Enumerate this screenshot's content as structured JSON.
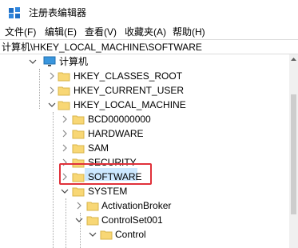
{
  "window": {
    "title": "注册表编辑器",
    "icon": "registry-editor-icon"
  },
  "menu": {
    "items": [
      {
        "label": "文件(F)"
      },
      {
        "label": "编辑(E)"
      },
      {
        "label": "查看(V)"
      },
      {
        "label": "收藏夹(A)"
      },
      {
        "label": "帮助(H)"
      }
    ]
  },
  "address": {
    "path": "计算机\\HKEY_LOCAL_MACHINE\\SOFTWARE"
  },
  "tree": {
    "root": {
      "label": "计算机",
      "icon": "computer-icon",
      "state": "expanded"
    },
    "items": [
      {
        "label": "HKEY_CLASSES_ROOT",
        "state": "collapsed"
      },
      {
        "label": "HKEY_CURRENT_USER",
        "state": "collapsed"
      },
      {
        "label": "HKEY_LOCAL_MACHINE",
        "state": "expanded"
      },
      {
        "label": "BCD00000000",
        "state": "collapsed"
      },
      {
        "label": "HARDWARE",
        "state": "collapsed"
      },
      {
        "label": "SAM",
        "state": "collapsed"
      },
      {
        "label": "SECURITY",
        "state": "collapsed"
      },
      {
        "label": "SOFTWARE",
        "state": "collapsed",
        "selected": true
      },
      {
        "label": "SYSTEM",
        "state": "expanded"
      },
      {
        "label": "ActivationBroker",
        "state": "collapsed"
      },
      {
        "label": "ControlSet001",
        "state": "expanded"
      },
      {
        "label": "Control",
        "state": "expanded"
      }
    ]
  },
  "colors": {
    "highlight_box": "#e0313a",
    "selection": "#cce8ff",
    "folder": "#f8d775"
  }
}
